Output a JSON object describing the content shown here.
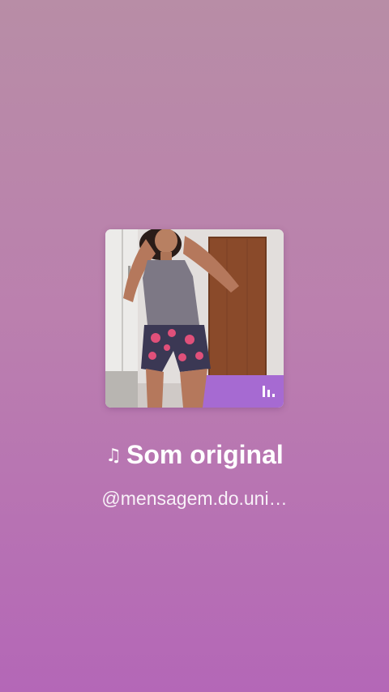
{
  "audio": {
    "title": "Som original",
    "note_icon": "♫",
    "author": "@mensagem.do.uni…"
  },
  "cover": {
    "badge_icon": "equalizer-bars-icon"
  },
  "colors": {
    "background_top": "#b88da6",
    "background_bottom": "#b467b7",
    "text": "#ffffff"
  }
}
